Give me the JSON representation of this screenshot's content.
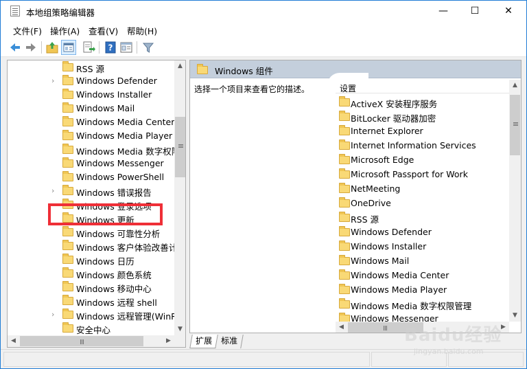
{
  "window": {
    "title": "本地组策略编辑器",
    "min_glyph": "—",
    "max_glyph": "☐",
    "close_glyph": "✕"
  },
  "menu": [
    "文件(F)",
    "操作(A)",
    "查看(V)",
    "帮助(H)"
  ],
  "toolbar": {
    "icons": [
      "back-icon",
      "forward-icon",
      "up-folder-icon",
      "show-hide-tree-icon",
      "export-list-icon",
      "help-icon",
      "properties-icon",
      "filter-icon"
    ]
  },
  "tree": {
    "items": [
      {
        "label": "RSS 源",
        "expandable": false
      },
      {
        "label": "Windows Defender",
        "expandable": true
      },
      {
        "label": "Windows Installer",
        "expandable": false
      },
      {
        "label": "Windows Mail",
        "expandable": false
      },
      {
        "label": "Windows Media Center",
        "expandable": false
      },
      {
        "label": "Windows Media Player",
        "expandable": false
      },
      {
        "label": "Windows Media 数字权限",
        "expandable": false
      },
      {
        "label": "Windows Messenger",
        "expandable": false
      },
      {
        "label": "Windows PowerShell",
        "expandable": false
      },
      {
        "label": "Windows 错误报告",
        "expandable": true
      },
      {
        "label": "Windows 登录选项",
        "expandable": false
      },
      {
        "label": "Windows 更新",
        "expandable": false
      },
      {
        "label": "Windows 可靠性分析",
        "expandable": false
      },
      {
        "label": "Windows 客户体验改善计",
        "expandable": false
      },
      {
        "label": "Windows 日历",
        "expandable": false
      },
      {
        "label": "Windows 颜色系统",
        "expandable": false
      },
      {
        "label": "Windows 移动中心",
        "expandable": false
      },
      {
        "label": "Windows 远程 shell",
        "expandable": false
      },
      {
        "label": "Windows 远程管理(WinR",
        "expandable": true
      },
      {
        "label": "安全中心",
        "expandable": false
      }
    ],
    "highlight_color": "#ef2f37"
  },
  "right": {
    "header_title": "Windows 组件",
    "description": "选择一个项目来查看它的描述。",
    "column_header": "设置",
    "items": [
      "ActiveX 安装程序服务",
      "BitLocker 驱动器加密",
      "Internet Explorer",
      "Internet Information Services",
      "Microsoft Edge",
      "Microsoft Passport for Work",
      "NetMeeting",
      "OneDrive",
      "RSS 源",
      "Windows Defender",
      "Windows Installer",
      "Windows Mail",
      "Windows Media Center",
      "Windows Media Player",
      "Windows Media 数字权限管理",
      "Windows Messenger"
    ]
  },
  "tabs": [
    "扩展",
    "标准"
  ],
  "scroll": {
    "up": "▲",
    "down": "▼",
    "left": "◀",
    "right": "▶"
  },
  "watermark": {
    "text": "Baidu经验",
    "sub": "jingyan.baidu.com"
  },
  "colors": {
    "accent": "#1E7CD6",
    "header_bg": "#c4cfdc",
    "folder": "#f9d976"
  }
}
